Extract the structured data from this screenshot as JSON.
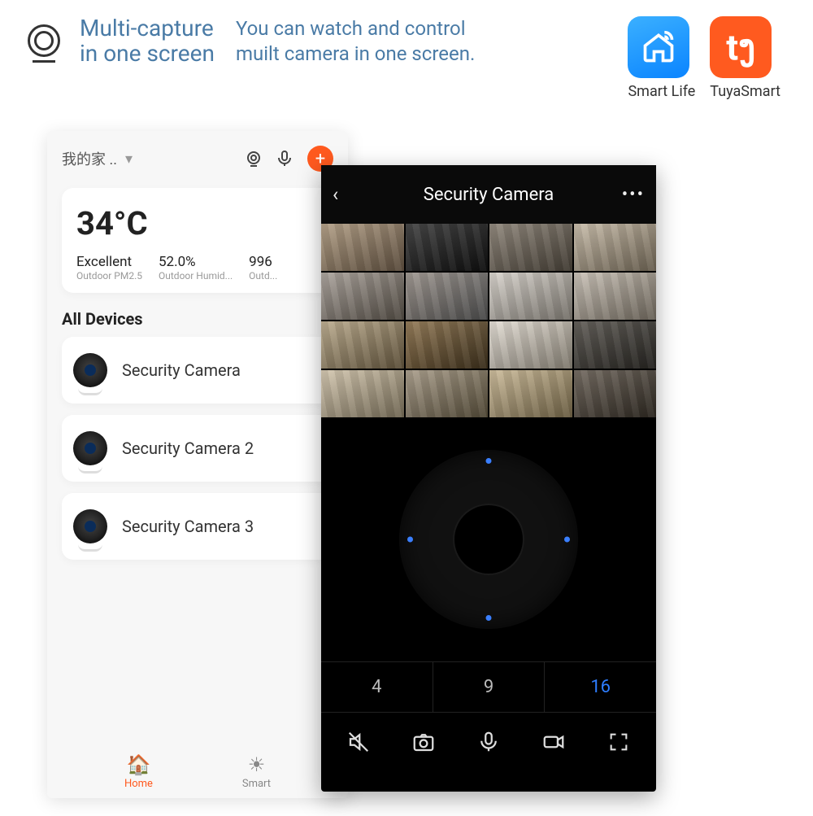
{
  "header": {
    "title_line1": "Multi-capture",
    "title_line2": "in one screen",
    "sub_line1": "You can watch and control",
    "sub_line2": "muilt camera in one screen."
  },
  "apps": {
    "smartlife": "Smart Life",
    "tuya": "TuyaSmart"
  },
  "home": {
    "room_dropdown": "我的家 ..",
    "temperature": "34°C",
    "metrics": [
      {
        "val": "Excellent",
        "lab": "Outdoor PM2.5"
      },
      {
        "val": "52.0%",
        "lab": "Outdoor Humid..."
      },
      {
        "val": "996",
        "lab": "Outd..."
      }
    ],
    "section": "All Devices",
    "devices": [
      "Security Camera",
      "Security Camera 2",
      "Security Camera 3"
    ],
    "tabs": {
      "home": "Home",
      "smart": "Smart"
    }
  },
  "camera": {
    "title": "Security Camera",
    "splits": [
      "4",
      "9",
      "16"
    ],
    "active_split_index": 2
  }
}
